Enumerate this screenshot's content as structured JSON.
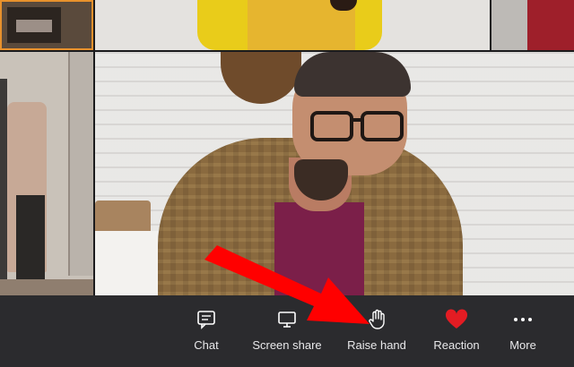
{
  "toolbar": {
    "items": [
      {
        "label": "Chat",
        "icon": "chat-icon"
      },
      {
        "label": "Screen share",
        "icon": "screen-share-icon"
      },
      {
        "label": "Raise hand",
        "icon": "hand-icon"
      },
      {
        "label": "Reaction",
        "icon": "heart-icon"
      },
      {
        "label": "More",
        "icon": "more-dots-icon"
      }
    ]
  },
  "colors": {
    "toolbar_bg": "#2b2b2e",
    "active_tile_border": "#e8912c",
    "reaction_heart": "#e31c23",
    "annotation_arrow": "#ff0000"
  }
}
